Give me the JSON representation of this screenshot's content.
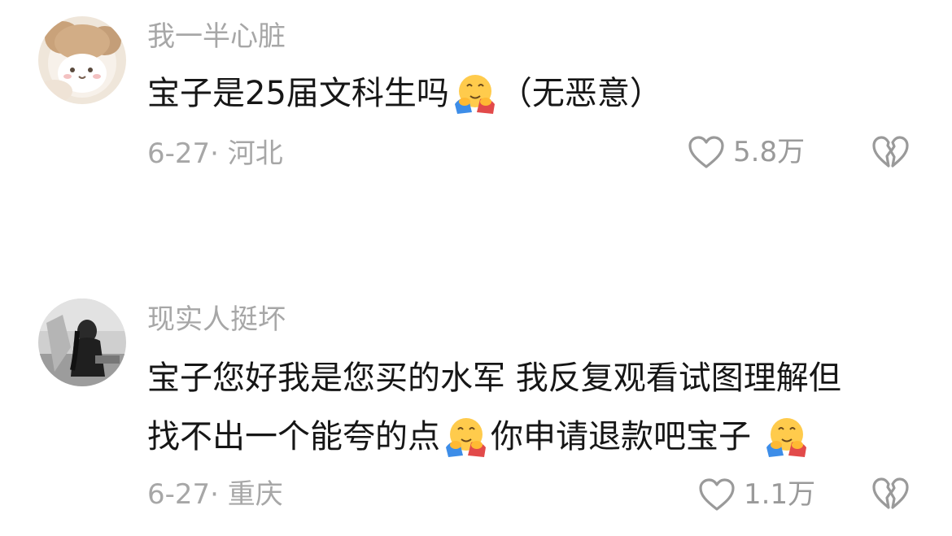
{
  "comments": [
    {
      "username": "我一半心脏",
      "lines": [
        {
          "before": "宝子是25届文科生吗",
          "after": "（无恶意）"
        }
      ],
      "date_location": "6-27· 河北",
      "likes": "5.8万"
    },
    {
      "username": "现实人挺坏",
      "lines": [
        {
          "text": "宝子您好我是您买的水军 我反复观看试图理解但"
        },
        {
          "before": "找不出一个能夸的点",
          "middle": "你申请退款吧宝子",
          "after": ""
        }
      ],
      "date_location": "6-27· 重庆",
      "likes": "1.1万"
    }
  ],
  "icons": {
    "like": "heart-outline-icon",
    "dislike": "broken-heart-icon",
    "emoji": "hugging-face-emoji"
  },
  "colors": {
    "text": "#161616",
    "muted": "#a7a7a7",
    "icon": "#9a9a9a"
  }
}
